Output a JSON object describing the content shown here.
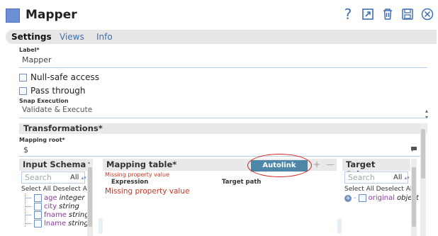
{
  "header": {
    "title": "Mapper",
    "icons": [
      "help-icon",
      "export-icon",
      "delete-icon",
      "save-icon",
      "close-icon"
    ]
  },
  "tabs": [
    {
      "label": "Settings",
      "active": true
    },
    {
      "label": "Views",
      "active": false
    },
    {
      "label": "Info",
      "active": false
    }
  ],
  "settings": {
    "label_caption": "Label*",
    "label_value": "Mapper",
    "null_safe_label": "Null-safe access",
    "pass_through_label": "Pass through",
    "snap_execution_caption": "Snap Execution",
    "snap_execution_value": "Validate & Execute"
  },
  "transformations": {
    "title": "Transformations*",
    "mapping_root_caption": "Mapping root*",
    "mapping_root_value": "$"
  },
  "input_schema": {
    "title": "Input Schema",
    "search_placeholder": "Search",
    "filter_value": "All",
    "select_all": "Select All",
    "deselect_all": "Deselect All",
    "fields": [
      {
        "name": "age",
        "type": "integer"
      },
      {
        "name": "city",
        "type": "string"
      },
      {
        "name": "fname",
        "type": "string"
      },
      {
        "name": "lname",
        "type": "string"
      }
    ]
  },
  "mapping_table": {
    "title": "Mapping table*",
    "autolink_label": "Autolink",
    "error_top": "Missing property value",
    "col_expression": "Expression",
    "col_target_path": "Target path",
    "error_row": "Missing property value"
  },
  "target_schema": {
    "title": "Target Schema",
    "search_placeholder": "Search",
    "filter_value": "All",
    "select_all": "Select All",
    "deselect_all": "Deselect All",
    "fields": [
      {
        "name": "original",
        "type": "object"
      }
    ]
  },
  "colors": {
    "accent": "#3e6fb0",
    "autolink_bg": "#4e86a8",
    "error": "#c0392b",
    "annotation": "#d02020"
  }
}
